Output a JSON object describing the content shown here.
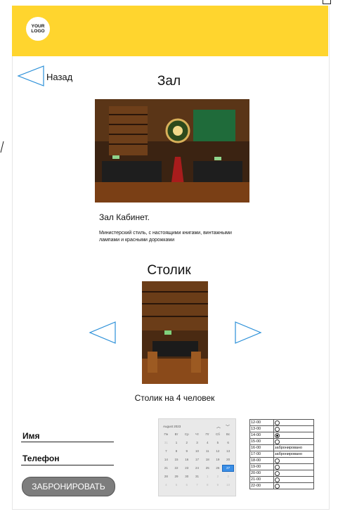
{
  "header": {
    "logo_text": "YOUR LOGO",
    "color": "#ffd52e"
  },
  "nav": {
    "back_label": "Назад"
  },
  "hall": {
    "title": "Зал",
    "name": "Зал Кабинет.",
    "description": "Министерский стиль, с настоящими книгами, винтажными лампами и красными дорожками"
  },
  "table": {
    "title": "Столик",
    "caption": "Столик на 4 человек"
  },
  "form": {
    "name_label": "Имя",
    "phone_label": "Телефон",
    "submit_label": "ЗАБРОНИРОВАТЬ"
  },
  "calendar": {
    "month_label": "August 2023",
    "weekdays": [
      "Пн",
      "Вт",
      "Ср",
      "Чт",
      "Пт",
      "Сб",
      "Вс"
    ],
    "days": [
      "31",
      "1",
      "2",
      "3",
      "4",
      "5",
      "6",
      "7",
      "8",
      "9",
      "10",
      "11",
      "12",
      "13",
      "14",
      "15",
      "16",
      "17",
      "18",
      "19",
      "20",
      "21",
      "22",
      "23",
      "24",
      "25",
      "26",
      "27",
      "28",
      "29",
      "30",
      "31",
      "1",
      "2",
      "3",
      "4",
      "5",
      "6",
      "7",
      "8",
      "9",
      "10"
    ],
    "selected": "27"
  },
  "slots": [
    {
      "time": "12-00",
      "status": ""
    },
    {
      "time": "13-00",
      "status": ""
    },
    {
      "time": "14-00",
      "status": "",
      "selected": true
    },
    {
      "time": "15-00",
      "status": ""
    },
    {
      "time": "16-00",
      "status": "забронировано"
    },
    {
      "time": "17-00",
      "status": "забронировано"
    },
    {
      "time": "18-00",
      "status": ""
    },
    {
      "time": "19-00",
      "status": ""
    },
    {
      "time": "20-00",
      "status": ""
    },
    {
      "time": "21-00",
      "status": ""
    },
    {
      "time": "22-00",
      "status": ""
    }
  ]
}
